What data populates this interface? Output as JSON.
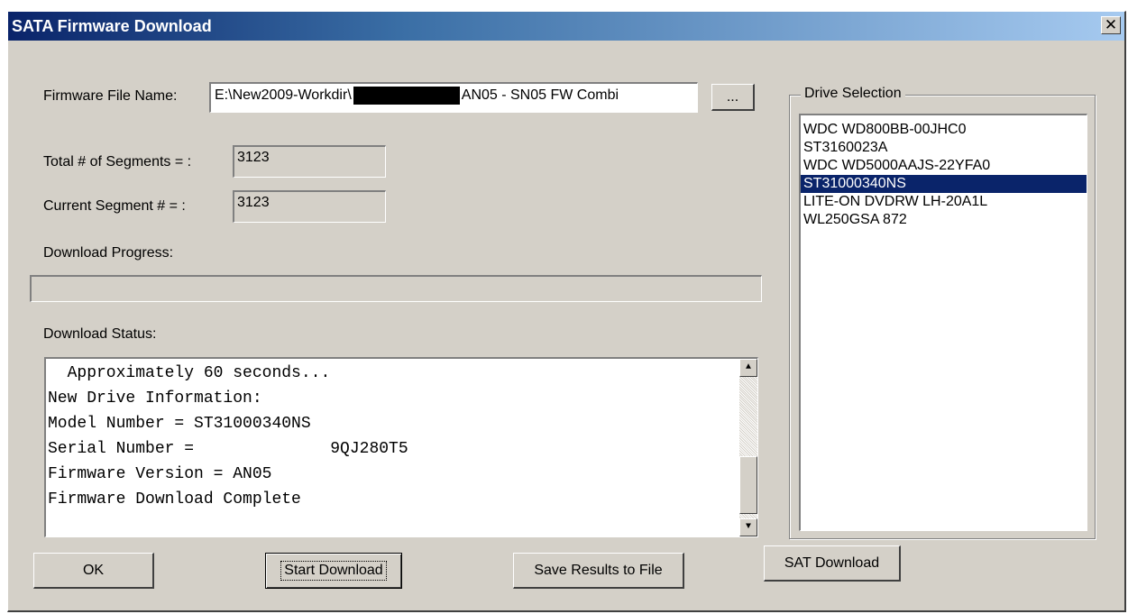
{
  "window": {
    "title": "SATA Firmware Download",
    "close_glyph": "✕"
  },
  "firmware": {
    "label": "Firmware File Name:",
    "value_prefix": "E:\\New2009-Workdir\\",
    "value_suffix": "AN05 - SN05 FW Combi",
    "browse_label": "..."
  },
  "segments": {
    "total_label": "Total # of Segments = :",
    "total_value": "3123",
    "current_label": "Current Segment # =   :",
    "current_value": "3123"
  },
  "progress": {
    "label": "Download Progress:",
    "percent": 0
  },
  "status": {
    "label": "Download Status:",
    "lines": [
      "  Approximately 60 seconds...",
      "New Drive Information:",
      "Model Number = ST31000340NS",
      "Serial Number =              9QJ280T5",
      "Firmware Version = AN05",
      "Firmware Download Complete"
    ],
    "scroll_up_glyph": "▲",
    "scroll_down_glyph": "▼"
  },
  "drives": {
    "label": "Drive Selection",
    "items": [
      " WDC WD800BB-00JHC0",
      " ST3160023A",
      " WDC WD5000AAJS-22YFA0",
      " ST31000340NS",
      "LITE-ON DVDRW LH-20A1L",
      "WL250GSA 872"
    ],
    "selected_index": 3
  },
  "buttons": {
    "ok": "OK",
    "start": "Start Download",
    "save": "Save Results to File",
    "sat": "SAT Download"
  },
  "colors": {
    "face": "#d4d0c8",
    "title_start": "#0a246a",
    "title_end": "#a6caf0",
    "selection": "#0a246a"
  }
}
